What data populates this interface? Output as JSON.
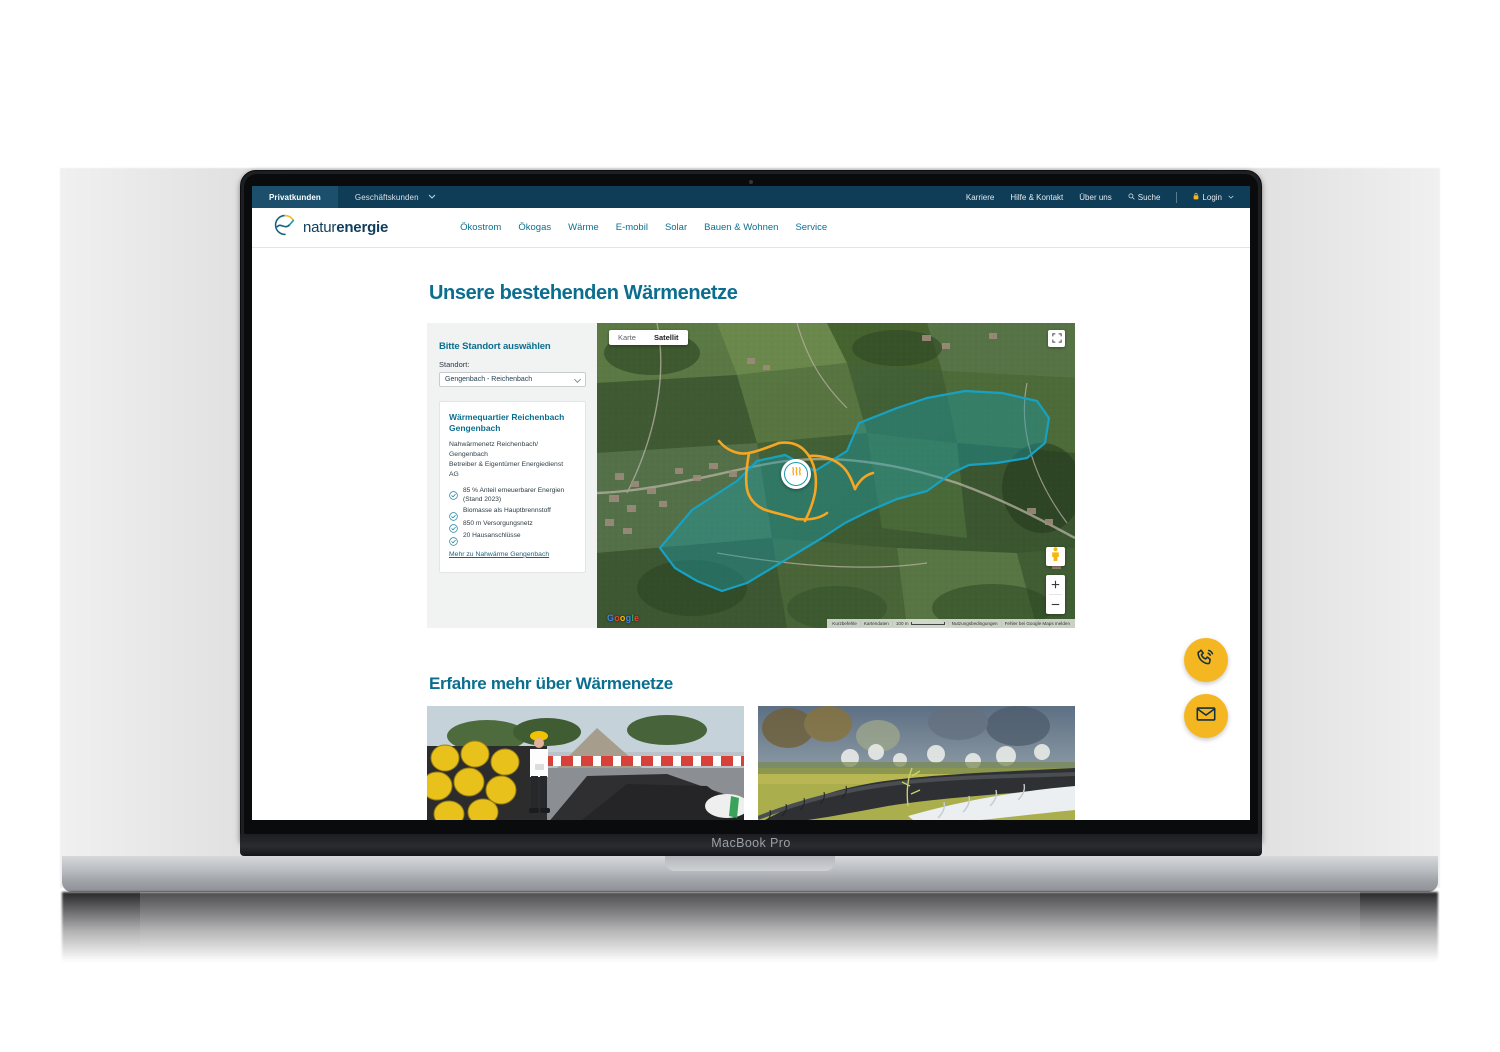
{
  "device": {
    "model_label": "MacBook Pro"
  },
  "utility_bar": {
    "tabs": [
      {
        "label": "Privatkunden",
        "active": true
      },
      {
        "label": "Geschäftskunden",
        "active": false,
        "has_chevron": true
      }
    ],
    "links": [
      "Karriere",
      "Hilfe & Kontakt",
      "Über uns"
    ],
    "search_label": "Suche",
    "login_label": "Login",
    "search_icon": "search-icon",
    "lock_icon": "lock-icon",
    "bg_color": "#0f3c56",
    "active_tab_color": "#1b4f6b"
  },
  "brand": {
    "name_light": "natur",
    "name_bold": "energie",
    "logo_icon": "naturenergie-leaf-logo",
    "text_color": "#0f3d5c",
    "arc_yellow": "#F5B721",
    "arc_teal": "#1a9aa8"
  },
  "main_nav": {
    "items": [
      "Ökostrom",
      "Ökogas",
      "Wärme",
      "E-mobil",
      "Solar",
      "Bauen & Wohnen",
      "Service"
    ],
    "link_color": "#0d6f8e"
  },
  "page": {
    "title": "Unsere bestehenden Wärmenetze",
    "section2_title": "Erfahre mehr über Wärmenetze",
    "heading_color": "#0b6e8e"
  },
  "sidebar": {
    "heading": "Bitte Standort auswählen",
    "select_label": "Standort:",
    "select_value": "Gengenbach - Reichenbach",
    "select_options": [
      "Gengenbach - Reichenbach"
    ],
    "card": {
      "title": "Wärmequartier Reichenbach Gengenbach",
      "description_line1": "Nahwärmenetz Reichenbach/",
      "description_line2": "Gengenbach",
      "description_line3": "Betreiber & Eigentümer Energiedienst",
      "description_line4": "AG",
      "facts": [
        "85 % Anteil erneuerbarer Energien (Stand 2023)",
        "Biomasse als Hauptbrennstoff",
        "850 m Versorgungsnetz",
        "20 Hausanschlüsse"
      ],
      "link": "Mehr zu Nahwärme Gengenbach",
      "check_icon": "check-circle-icon"
    },
    "panel_bg": "#f1f2f2"
  },
  "map": {
    "type_buttons": [
      {
        "label": "Karte",
        "active": false
      },
      {
        "label": "Satellit",
        "active": true
      }
    ],
    "fullscreen_icon": "fullscreen-icon",
    "pegman_icon": "street-view-pegman-icon",
    "zoom_in_label": "+",
    "zoom_out_label": "−",
    "marker_icon": "heat-waves-icon",
    "google_logo": "Google",
    "google_letters": [
      "G",
      "o",
      "o",
      "g",
      "l",
      "e"
    ],
    "attribution": {
      "shortcuts": "Kurzbefehle",
      "map_data": "Kartendaten",
      "scale": "100 m",
      "terms": "Nutzungsbedingungen",
      "report": "Fehler bei Google Maps melden"
    },
    "overlay": {
      "area_fill": "#1a9aa8",
      "area_stroke": "#17a2c4",
      "network_line": "#F5A623"
    }
  },
  "teasers": [
    {
      "alt": "Gestapelte Fernwärmerohre mit Bauarbeiter in gelbem Helm",
      "name": "teaser-image-pipes-worker"
    },
    {
      "alt": "Verlegte Wärmenetzrohre im Grünen",
      "name": "teaser-image-pipes-field"
    }
  ],
  "fabs": [
    {
      "icon": "phone-icon",
      "name": "contact-phone-button"
    },
    {
      "icon": "mail-icon",
      "name": "contact-mail-button"
    }
  ],
  "colors": {
    "brand_yellow": "#F5B721",
    "brand_teal": "#0b6e8e",
    "dark_blue": "#0f3c56"
  }
}
